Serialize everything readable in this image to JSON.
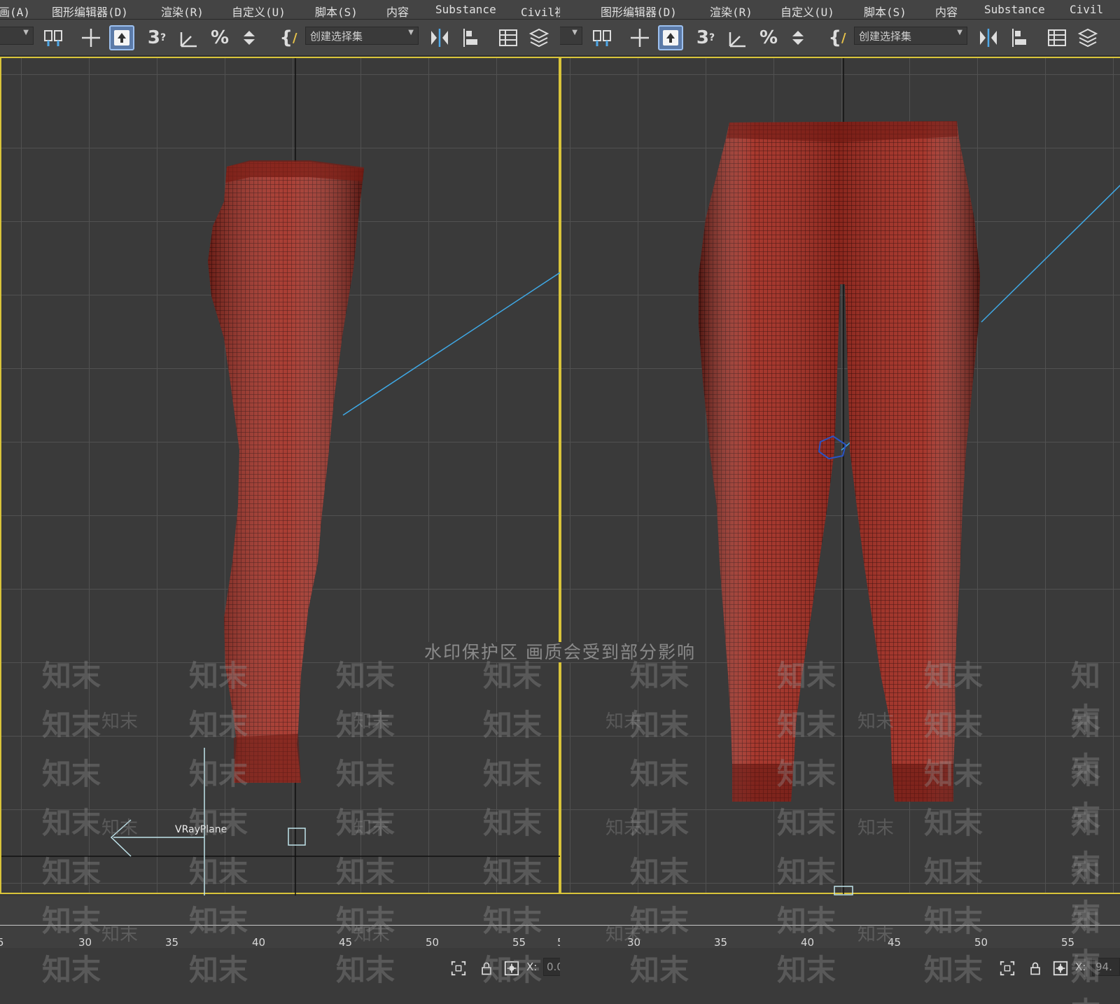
{
  "menu": {
    "left": [
      "画(A)",
      "图形编辑器(D)",
      "渲染(R)",
      "自定义(U)",
      "脚本(S)",
      "内容",
      "Substance",
      "Civil视图(A)"
    ],
    "right": [
      "图形编辑器(D)",
      "渲染(R)",
      "自定义(U)",
      "脚本(S)",
      "内容",
      "Substance",
      "Civil"
    ]
  },
  "toolbar": {
    "selection_set_placeholder": "创建选择集",
    "icons": [
      "select-and-link-icon",
      "move-icon",
      "select-object-icon",
      "snaps-3d-icon",
      "angle-snap-icon",
      "percent-snap-icon",
      "spinner-snap-icon",
      "named-selection-edit-icon",
      "mirror-icon",
      "align-icon",
      "scene-explorer-icon",
      "layer-manager-icon"
    ]
  },
  "viewport": {
    "object_label": "VRayPlane",
    "mesh_color": "#9c2a20",
    "wire_color": "#3d0a07",
    "frame_color": "#d9c43a",
    "light_line_color": "#3fa9e6"
  },
  "timeline": {
    "left_ticks": [
      "5",
      "30",
      "35",
      "40",
      "45",
      "50",
      "55",
      "5"
    ],
    "right_ticks": [
      "30",
      "35",
      "40",
      "45",
      "50",
      "55"
    ]
  },
  "status": {
    "x_label": "X:",
    "x_value_left": "0.0",
    "x_value_right": "94."
  },
  "watermark": {
    "header": "水印保护区  画质会受到部分影响",
    "text": "知末"
  }
}
